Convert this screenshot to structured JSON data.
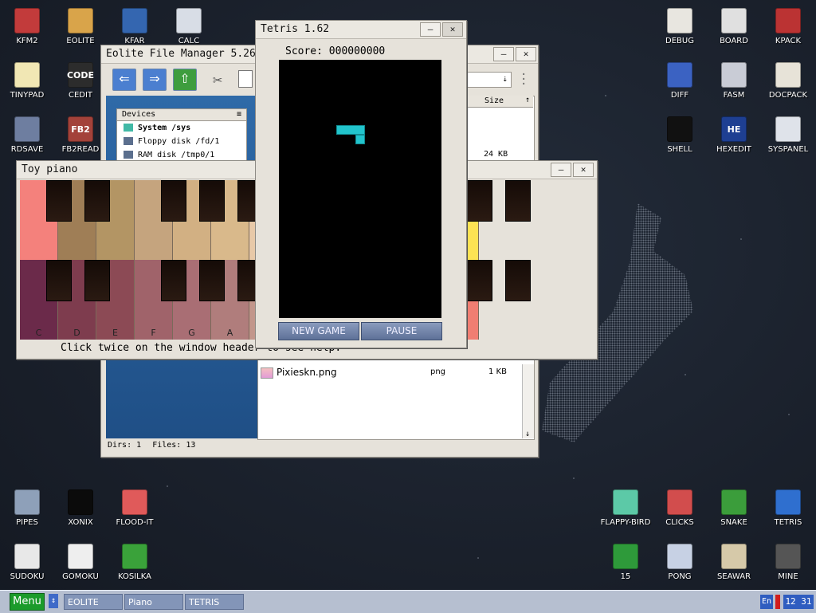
{
  "desktop": {
    "icons_left": [
      {
        "label": "KFM2",
        "icon": "floppy-icon",
        "color": "#c23b3b"
      },
      {
        "label": "EOLITE",
        "icon": "folder-icon",
        "color": "#d9a44a"
      },
      {
        "label": "KFAR",
        "icon": "archive-icon",
        "color": "#3466b0"
      },
      {
        "label": "CALC",
        "icon": "calculator-icon",
        "color": "#d8dde6"
      },
      {
        "label": "TINYPAD",
        "icon": "notepad-icon",
        "color": "#f1e7b4"
      },
      {
        "label": "CEDIT",
        "icon": "code-icon",
        "color": "#2c2c2c",
        "text": "CODE"
      },
      {
        "label": "RDSAVE",
        "icon": "save-disk-icon",
        "color": "#6e7ea0"
      },
      {
        "label": "FB2READ",
        "icon": "book-icon",
        "color": "#a3423a",
        "text": "FB2"
      }
    ],
    "icons_right": [
      {
        "label": "DEBUG",
        "icon": "bug-icon",
        "color": "#e8e6e0"
      },
      {
        "label": "BOARD",
        "icon": "board-icon",
        "color": "#e0e0e0"
      },
      {
        "label": "KPACK",
        "icon": "hammer-icon",
        "color": "#b33"
      },
      {
        "label": "DIFF",
        "icon": "diff-icon",
        "color": "#3b62c2"
      },
      {
        "label": "FASM",
        "icon": "assembler-icon",
        "color": "#c9ccd6"
      },
      {
        "label": "DOCPACK",
        "icon": "drawer-icon",
        "color": "#e7e3d8"
      },
      {
        "label": "SHELL",
        "icon": "terminal-icon",
        "color": "#111"
      },
      {
        "label": "HEXEDIT",
        "icon": "hex-icon",
        "color": "#1e3f92",
        "text": "HE"
      },
      {
        "label": "SYSPANEL",
        "icon": "sliders-icon",
        "color": "#dfe3ea"
      }
    ],
    "icons_bottom_left": [
      {
        "label": "PIPES",
        "icon": "pipes-icon",
        "color": "#8ea0b9"
      },
      {
        "label": "XONIX",
        "icon": "xonix-icon",
        "color": "#0b0b0b"
      },
      {
        "label": "FLOOD-IT",
        "icon": "flood-icon",
        "color": "#e05a5a"
      },
      {
        "label": "SUDOKU",
        "icon": "sudoku-icon",
        "color": "#e8e8e8"
      },
      {
        "label": "GOMOKU",
        "icon": "gomoku-icon",
        "color": "#eeeeee"
      },
      {
        "label": "KOSILKA",
        "icon": "lawnmower-icon",
        "color": "#3aa23a"
      }
    ],
    "icons_bottom_right": [
      {
        "label": "FLAPPY-BIRD",
        "icon": "bird-icon",
        "color": "#5cc9a7"
      },
      {
        "label": "CLICKS",
        "icon": "clicks-icon",
        "color": "#d24d4d"
      },
      {
        "label": "SNAKE",
        "icon": "snake-icon",
        "color": "#3b9d3b"
      },
      {
        "label": "TETRIS",
        "icon": "tetris-icon",
        "color": "#2f6fcf"
      },
      {
        "label": "15",
        "icon": "fifteen-icon",
        "color": "#2e9a3a"
      },
      {
        "label": "PONG",
        "icon": "pong-icon",
        "color": "#c7d1e4"
      },
      {
        "label": "SEAWAR",
        "icon": "ship-icon",
        "color": "#d6c9a9"
      },
      {
        "label": "MINE",
        "icon": "mine-icon",
        "color": "#555"
      }
    ]
  },
  "file_manager": {
    "title": "Eolite File Manager 5.26",
    "devices_header": "Devices",
    "devices": [
      "System /sys",
      "Floppy disk /fd/1",
      "RAM disk /tmp0/1"
    ],
    "size_header": "Size",
    "size_value": "24 KB",
    "file": {
      "name": "Pixieskn.png",
      "ext": "png",
      "size": "1 KB"
    },
    "status": {
      "dirs": "Dirs: 1",
      "files": "Files: 13"
    }
  },
  "piano": {
    "title": "Toy piano",
    "notes": [
      "C",
      "D",
      "E",
      "F",
      "G",
      "A"
    ],
    "help_text": "Click twice on the window header to see help.",
    "top_colors": [
      "#f4817c",
      "#9f7e56",
      "#b39564",
      "#c5a47e",
      "#d2b083",
      "#d9b98b",
      "#e8c9a8",
      "#f0d3cb",
      "#ecc8c8",
      "#f4c9c9",
      "#fde0de",
      "#fde354"
    ],
    "bottom_colors": [
      "#6b2a4a",
      "#7e3c4e",
      "#8c4a55",
      "#a0636a",
      "#a96e74",
      "#b07d7c",
      "#c2968b",
      "#d2a283",
      "#d9a470",
      "#d7a070",
      "#e4ad7c",
      "#f07e72"
    ]
  },
  "tetris": {
    "title": "Tetris 1.62",
    "score_label": "Score:",
    "score_value": "000000000",
    "new_game": "NEW GAME",
    "pause": "PAUSE",
    "piece_color": "#22c4cc"
  },
  "taskbar": {
    "menu": "Menu",
    "items": [
      "EOLITE",
      "Piano",
      "TETRIS"
    ],
    "lang": "En",
    "time": "12 31"
  }
}
